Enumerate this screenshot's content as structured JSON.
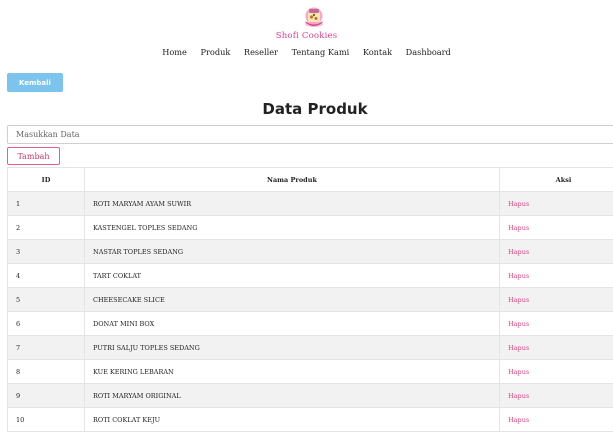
{
  "brand": {
    "name": "Shofi Cookies",
    "logo_icon": "cookie-jar-logo-icon"
  },
  "nav": [
    "Home",
    "Produk",
    "Reseller",
    "Tentang Kami",
    "Kontak",
    "Dashboard"
  ],
  "back_button": "Kembali",
  "page_title": "Data Produk",
  "input": {
    "placeholder": "Masukkan Data",
    "value": ""
  },
  "add_button": "Tambah",
  "table": {
    "headers": [
      "ID",
      "Nama Produk",
      "Aksi"
    ],
    "rows": [
      {
        "id": "1",
        "name": "ROTI MARYAM AYAM SUWIR",
        "action": "Hapus"
      },
      {
        "id": "2",
        "name": "KASTENGEL TOPLES SEDANG",
        "action": "Hapus"
      },
      {
        "id": "3",
        "name": "NASTAR TOPLES SEDANG",
        "action": "Hapus"
      },
      {
        "id": "4",
        "name": "TART COKLAT",
        "action": "Hapus"
      },
      {
        "id": "5",
        "name": "CHEESECAKE SLICE",
        "action": "Hapus"
      },
      {
        "id": "6",
        "name": "DONAT MINI BOX",
        "action": "Hapus"
      },
      {
        "id": "7",
        "name": "PUTRI SALJU TOPLES SEDANG",
        "action": "Hapus"
      },
      {
        "id": "8",
        "name": "KUE KERING LEBARAN",
        "action": "Hapus"
      },
      {
        "id": "9",
        "name": "ROTI MARYAM ORIGINAL",
        "action": "Hapus"
      },
      {
        "id": "10",
        "name": "ROTI COKLAT KEJU",
        "action": "Hapus"
      }
    ]
  },
  "colors": {
    "brand_pink": "#e0408c",
    "link_pink": "#d8477f",
    "back_button_blue": "#7cc3ee"
  }
}
